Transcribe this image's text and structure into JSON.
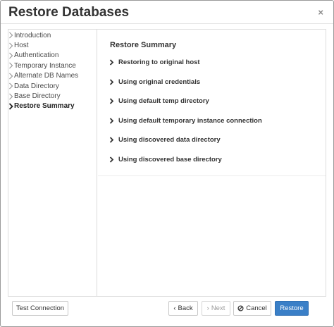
{
  "dialog": {
    "title": "Restore Databases",
    "close_glyph": "×"
  },
  "steps": [
    {
      "label": "Introduction"
    },
    {
      "label": "Host"
    },
    {
      "label": "Authentication"
    },
    {
      "label": "Temporary Instance"
    },
    {
      "label": "Alternate DB Names"
    },
    {
      "label": "Data Directory"
    },
    {
      "label": "Base Directory"
    },
    {
      "label": "Restore Summary"
    }
  ],
  "active_step": "Restore Summary",
  "summary": {
    "title": "Restore Summary",
    "items": [
      {
        "label": "Restoring to original host"
      },
      {
        "label": "Using original credentials"
      },
      {
        "label": "Using default temp directory"
      },
      {
        "label": "Using default temporary instance connection"
      },
      {
        "label": "Using discovered data directory"
      },
      {
        "label": "Using discovered base directory"
      }
    ]
  },
  "footer": {
    "test_connection": "Test Connection",
    "back": "Back",
    "back_glyph": "‹",
    "next": "Next",
    "next_glyph": "›",
    "cancel": "Cancel",
    "cancel_icon": "ban-icon",
    "restore": "Restore"
  },
  "colors": {
    "primary_button": "#3a7fc7",
    "border": "#dcdcdc"
  }
}
